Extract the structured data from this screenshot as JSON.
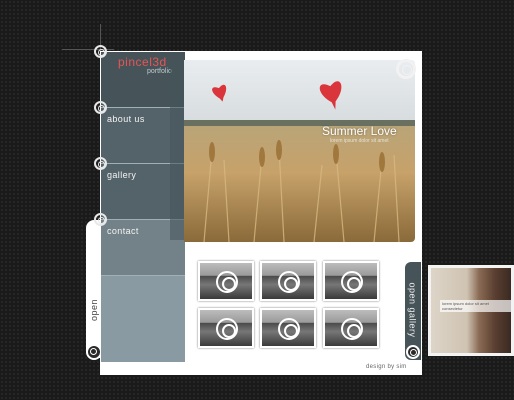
{
  "brand": {
    "title": "pincel3d",
    "subtitle": "portfolio"
  },
  "nav": {
    "items": [
      {
        "label": "about us"
      },
      {
        "label": "gallery"
      },
      {
        "label": "contact"
      }
    ]
  },
  "hero": {
    "title": "Summer Love",
    "subtitle": "lorem ipsum dolor sit amet"
  },
  "tabs": {
    "open_label": "open",
    "open_gallery_label": "open gallery"
  },
  "footer": {
    "credit": "design by sim"
  },
  "side_photo": {
    "caption": "lorem ipsum dolor sit amet consectetur"
  },
  "colors": {
    "background": "#1a1a1a",
    "sidebar": "#465459",
    "accent": "#e65454",
    "panel": "#ffffff"
  }
}
